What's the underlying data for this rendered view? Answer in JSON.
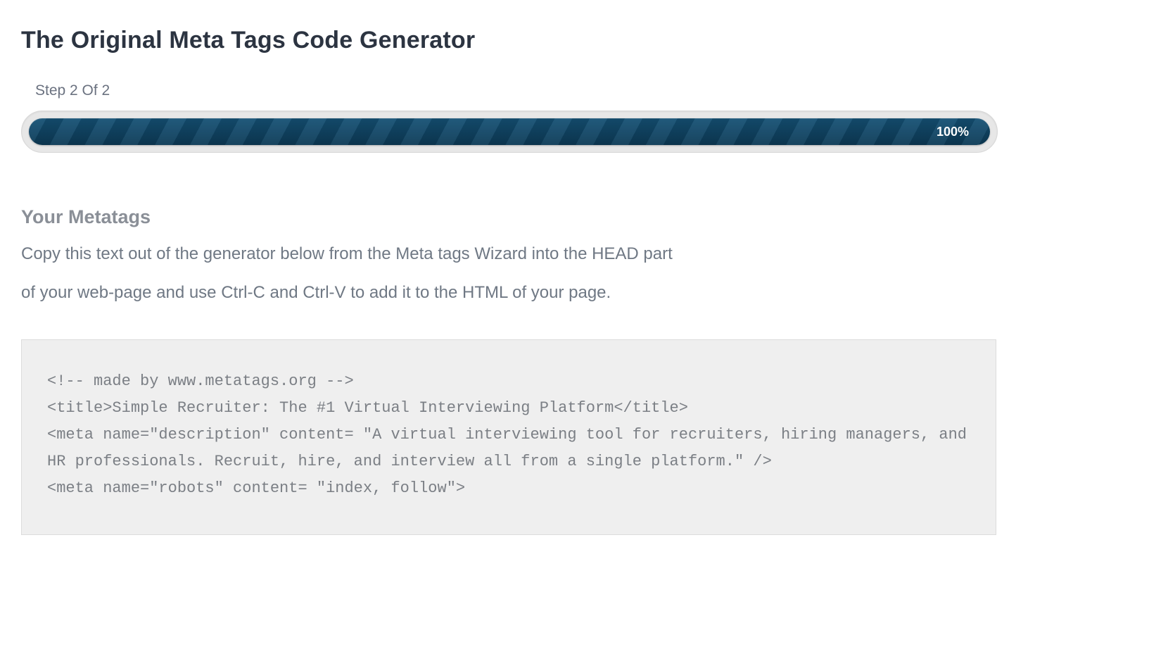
{
  "header": {
    "title": "The Original Meta Tags Code Generator"
  },
  "progress": {
    "step_label": "Step 2 Of 2",
    "percent_text": "100%"
  },
  "section": {
    "title": "Your Metatags",
    "instruction_line_1": "Copy this text out of the generator below from the Meta tags Wizard into the HEAD part",
    "instruction_line_2": "of your web-page and use Ctrl-C and Ctrl-V to add it to the HTML of your page."
  },
  "code_output": "<!-- made by www.metatags.org -->\n<title>Simple Recruiter: The #1 Virtual Interviewing Platform</title>\n<meta name=\"description\" content= \"A virtual interviewing tool for recruiters, hiring managers, and HR professionals. Recruit, hire, and interview all from a single platform.\" />\n<meta name=\"robots\" content= \"index, follow\">"
}
